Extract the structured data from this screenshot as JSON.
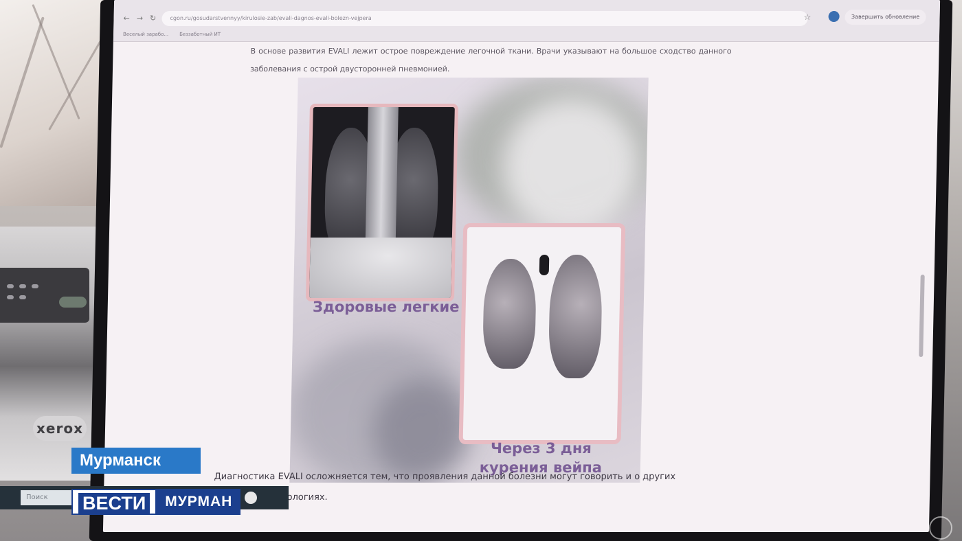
{
  "browser": {
    "url": "cgon.ru/gosudarstvennyy/kirulosie-zab/evali-dagnos-evali-bolezn-vejpera",
    "update_button": "Завершить обновление",
    "bookmarks": [
      "Веселый зарабо...",
      "Беззаботный ИТ"
    ]
  },
  "article": {
    "intro": "В основе развития EVALI лежит острое повреждение легочной ткани. Врачи указывают на большое сходство данного заболевания с острой двусторонней пневмонией.",
    "figure": {
      "caption_healthy": "Здоровые легкие",
      "caption_vape_line1": "Через 3 дня",
      "caption_vape_line2": "курения вейпа"
    },
    "para2": "Диагностика EVALI осложняется тем, что проявления данной болезни могут говорить и о других возможных патологиях."
  },
  "taskbar": {
    "search_placeholder": "Поиск"
  },
  "overlay": {
    "city": "Мурманск",
    "brand": "ВЕСТИ",
    "region": "МУРМАН"
  },
  "background": {
    "printer_brand": "xerox"
  },
  "colors": {
    "city_bar": "#2a79c8",
    "brand_blue": "#1b3f8e",
    "caption_purple": "#7b5e97",
    "frame_pink": "#e6b8bd"
  }
}
